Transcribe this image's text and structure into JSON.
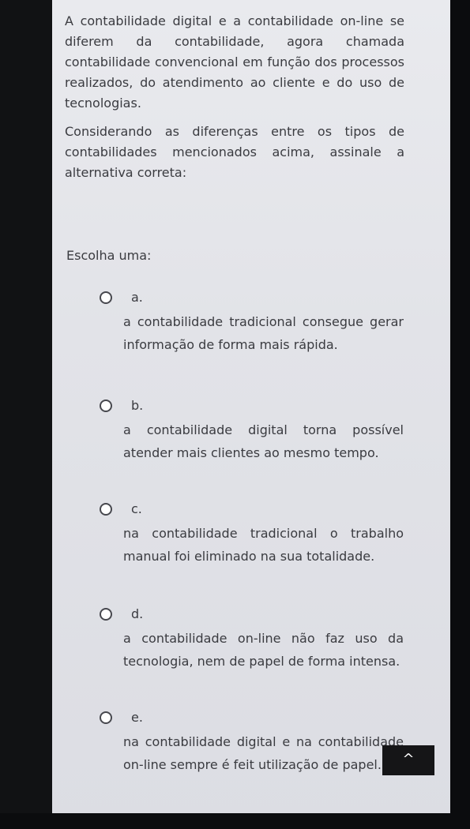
{
  "question": {
    "paragraph1": "A contabilidade digital e a contabilidade on-line se diferem da contabilidade, agora chamada contabilidade convencional em função dos processos realizados, do atendimento ao cliente e do uso de tecnologias.",
    "paragraph2": "Considerando as diferenças entre os tipos de contabilidades mencionados acima, assinale a alternativa correta:"
  },
  "prompt_label": "Escolha uma:",
  "options": [
    {
      "letter": "a.",
      "text": "a contabilidade tradicional consegue gerar informação de forma mais rápida."
    },
    {
      "letter": "b.",
      "text": "a contabilidade digital torna possível atender mais clientes ao mesmo tempo."
    },
    {
      "letter": "c.",
      "text": "na contabilidade tradicional o trabalho manual foi eliminado na sua totalidade."
    },
    {
      "letter": "d.",
      "text": "a contabilidade on-line não faz uso da tecnologia, nem de papel de forma intensa."
    },
    {
      "letter": "e.",
      "text": "na contabilidade digital e na contabilidade on-line sempre é feit utilização de papel."
    }
  ],
  "scroll_top": {
    "icon": "chevron-up-icon",
    "glyph": "^"
  }
}
